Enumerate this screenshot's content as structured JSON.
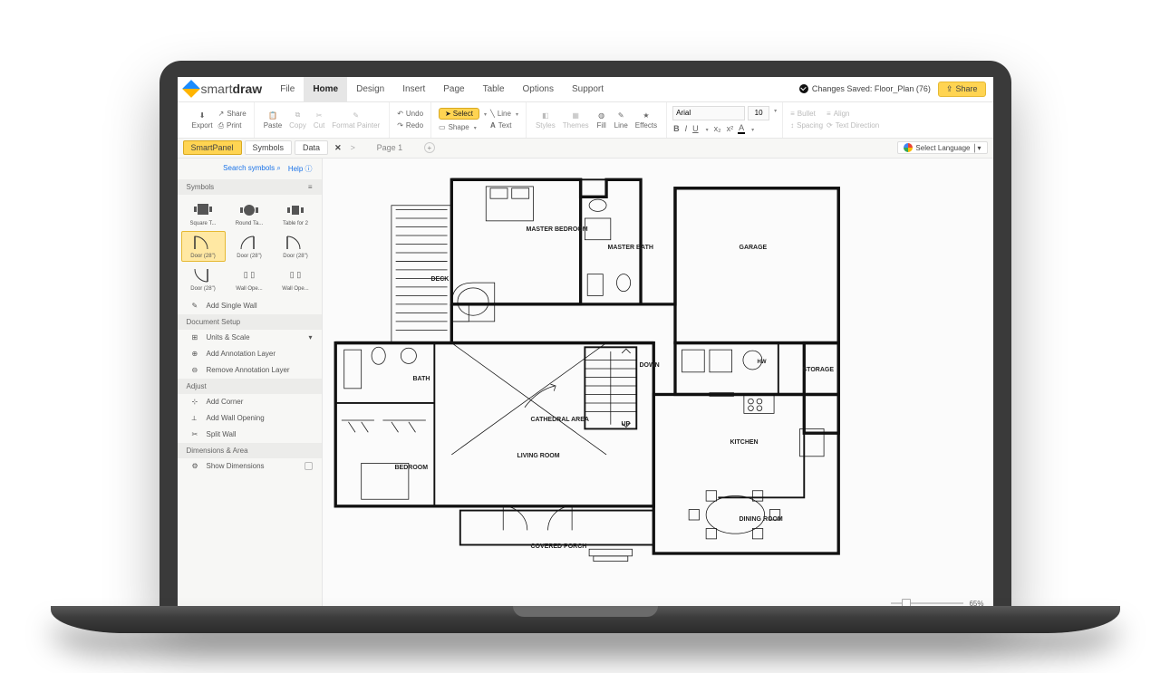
{
  "brand": {
    "prefix": "smart",
    "suffix": "draw"
  },
  "menus": [
    "File",
    "Home",
    "Design",
    "Insert",
    "Page",
    "Table",
    "Options",
    "Support"
  ],
  "active_menu": "Home",
  "save_status": {
    "text": "Changes Saved: Floor_Plan (76)"
  },
  "share_label": "Share",
  "ribbon": {
    "export": "Export",
    "share": "Share",
    "print": "Print",
    "paste": "Paste",
    "copy": "Copy",
    "cut": "Cut",
    "format_painter": "Format Painter",
    "undo": "Undo",
    "redo": "Redo",
    "select": "Select",
    "shape": "Shape",
    "line": "Line",
    "text": "Text",
    "styles": "Styles",
    "themes": "Themes",
    "fill": "Fill",
    "line_tool": "Line",
    "effects": "Effects",
    "font": "Arial",
    "size": "10",
    "bullet": "Bullet",
    "align": "Align",
    "spacing": "Spacing",
    "text_dir": "Text Direction"
  },
  "panel_tabs": [
    "SmartPanel",
    "Symbols",
    "Data"
  ],
  "active_panel": "SmartPanel",
  "page_label": "Page 1",
  "lang_label": "Select Language",
  "sidebar": {
    "search": "Search symbols",
    "help": "Help",
    "symbols_header": "Symbols",
    "sym_row1": [
      "Square T...",
      "Round Ta...",
      "Table for 2"
    ],
    "sym_row2": [
      "Door (28\")",
      "Door (28\")",
      "Door (28\")"
    ],
    "sym_row3": [
      "Door (28\")",
      "Wall Ope...",
      "Wall Ope..."
    ],
    "add_wall": "Add Single Wall",
    "doc_setup": "Document Setup",
    "doc_items": [
      "Units & Scale",
      "Add Annotation Layer",
      "Remove Annotation Layer"
    ],
    "adjust": "Adjust",
    "adjust_items": [
      "Add Corner",
      "Add Wall Opening",
      "Split Wall"
    ],
    "dims": "Dimensions & Area",
    "dims_items": [
      "Show Dimensions"
    ]
  },
  "floorplan": {
    "labels": {
      "deck": "DECK",
      "master_bedroom": "MASTER BEDROOM",
      "master_bath": "MASTER BATH",
      "garage": "GARAGE",
      "bath": "BATH",
      "storage": "STORAGE",
      "down": "DOWN",
      "up": "UP",
      "hw": "HW",
      "cathedral": "CATHEDRAL AREA",
      "living": "LIVING ROOM",
      "bedroom": "BEDROOM",
      "kitchen": "KITCHEN",
      "dining": "DINING ROOM",
      "porch": "COVERED PORCH"
    }
  },
  "zoom": "65%"
}
